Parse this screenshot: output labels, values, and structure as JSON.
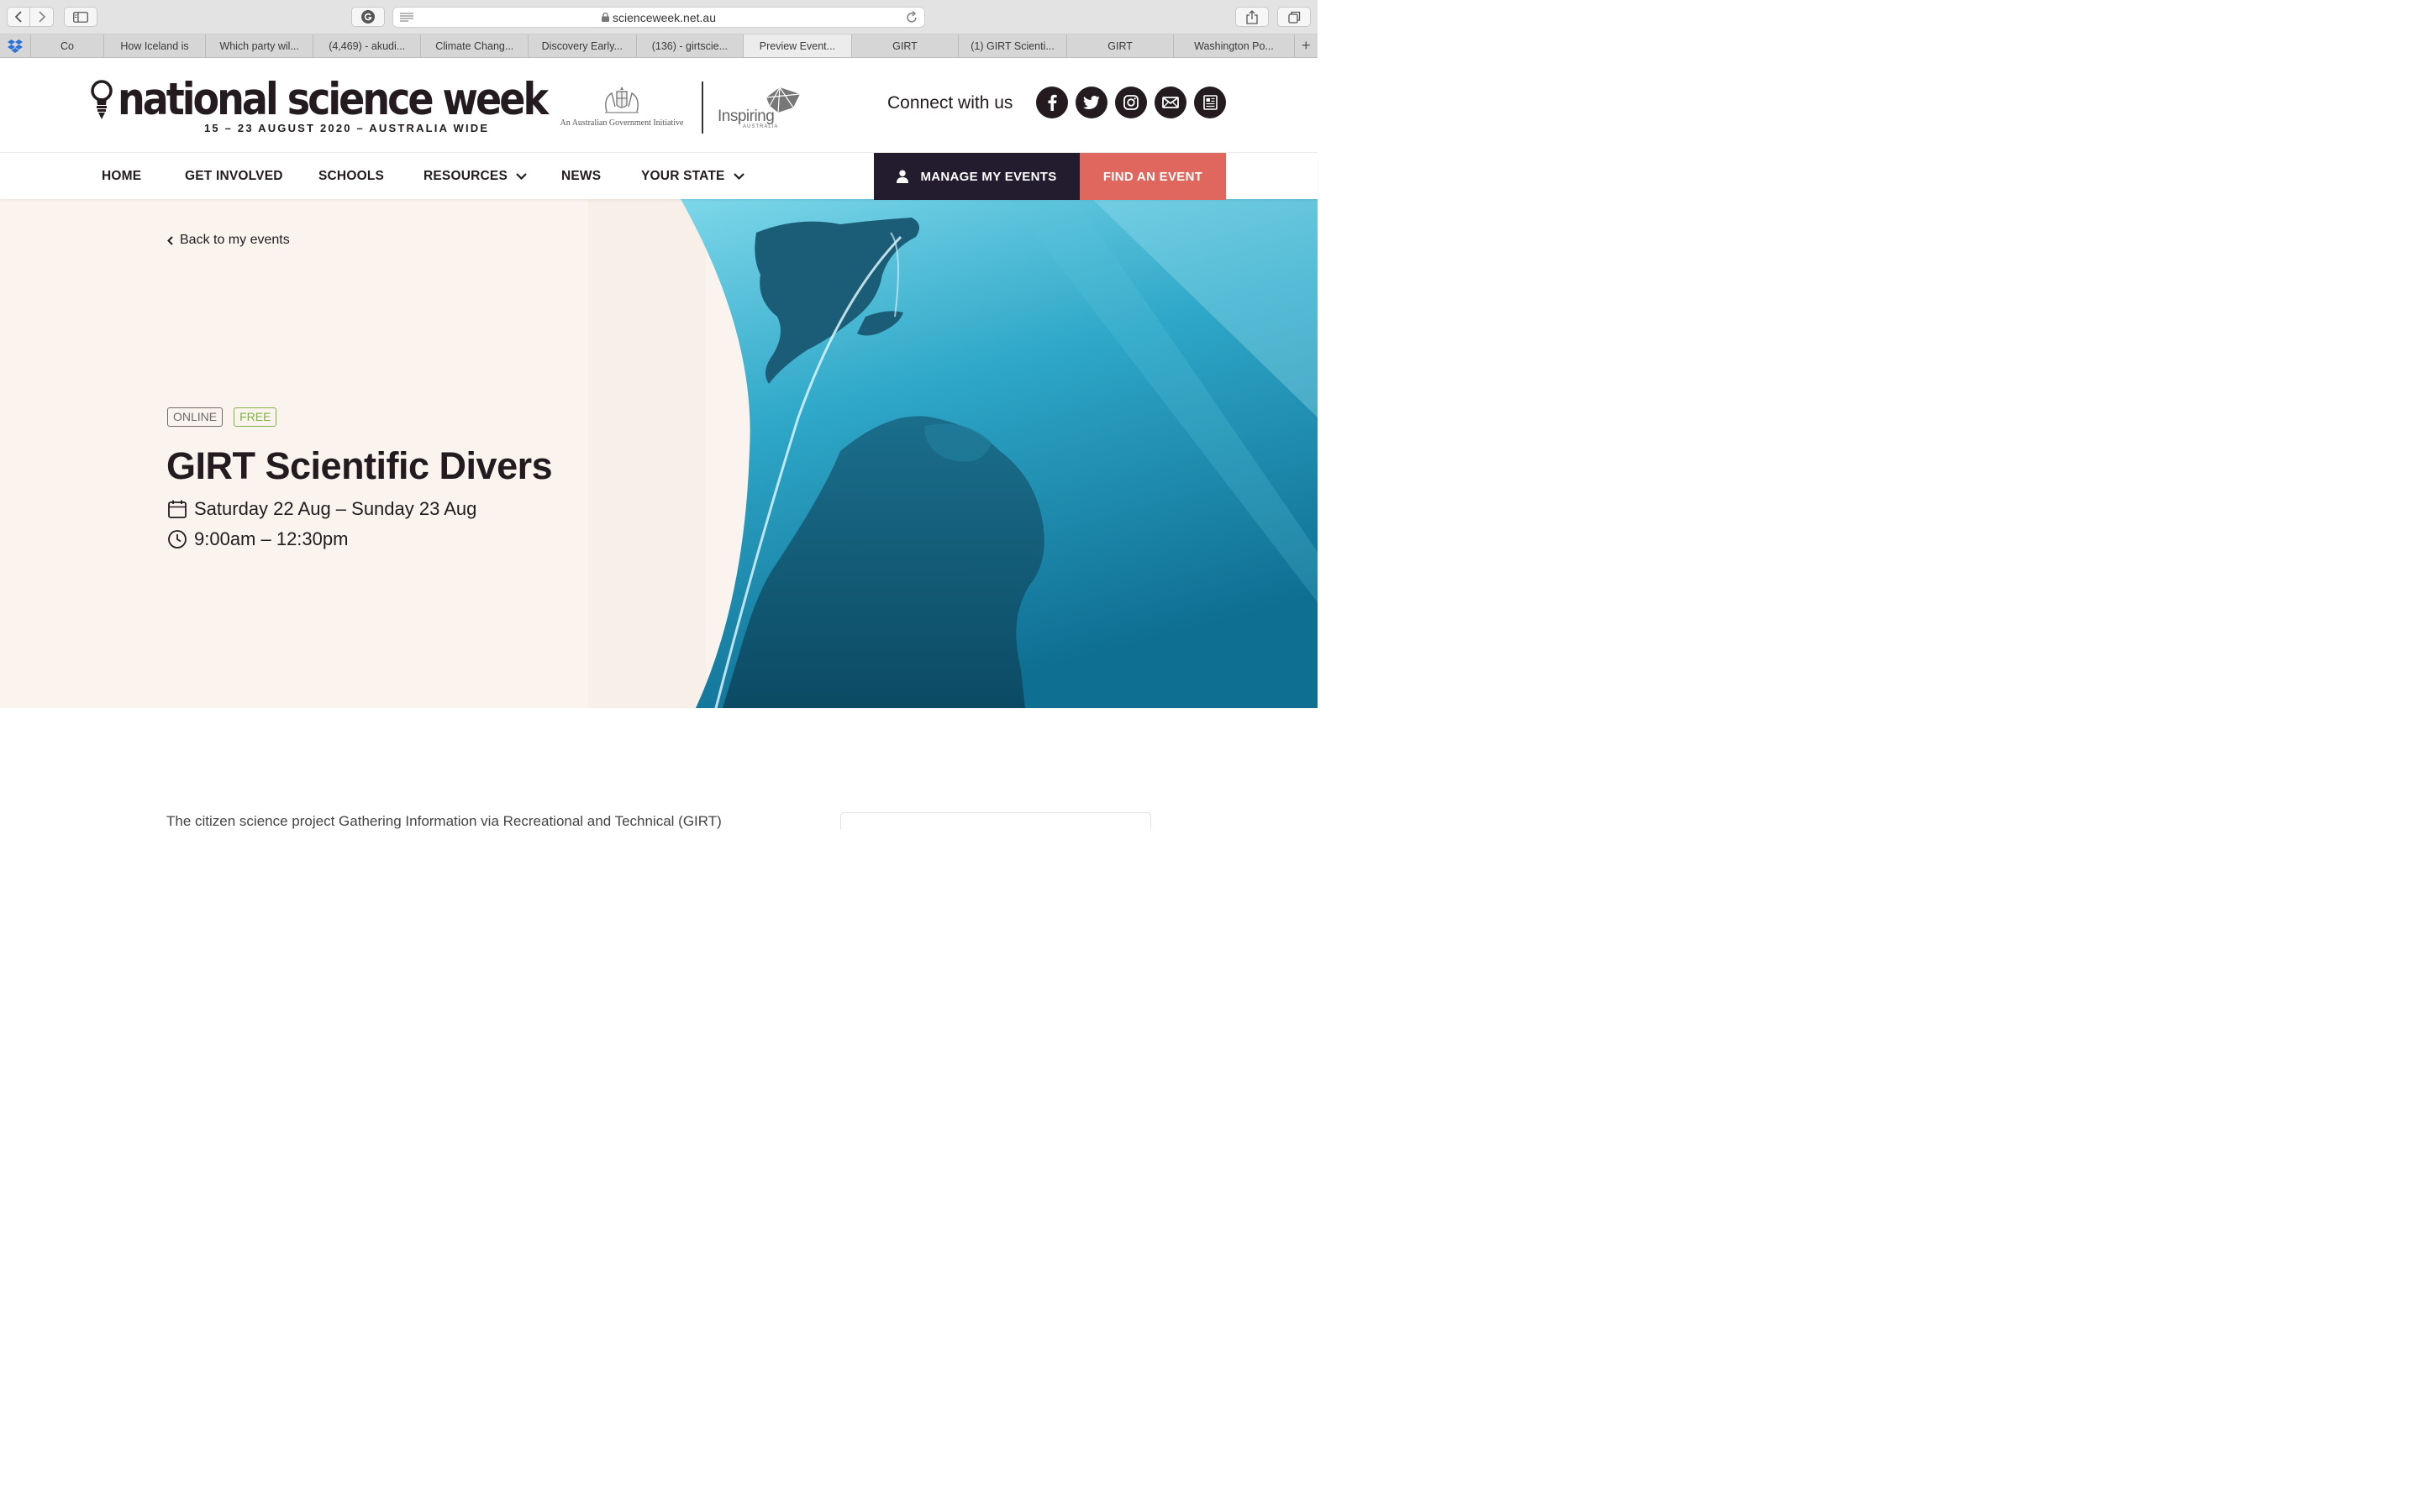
{
  "browser": {
    "url": "scienceweek.net.au",
    "tabs": [
      {
        "label": "Co",
        "width": 88
      },
      {
        "label": "How Iceland is",
        "width": 124
      },
      {
        "label": "Which party wil...",
        "width": 130
      },
      {
        "label": "(4,469) - akudi...",
        "width": 131
      },
      {
        "label": "Climate Chang...",
        "width": 130
      },
      {
        "label": "Discovery Early...",
        "width": 131
      },
      {
        "label": "(136) - girtscie...",
        "width": 130
      },
      {
        "label": "Preview Event...",
        "width": 131,
        "active": true
      },
      {
        "label": "GIRT",
        "width": 130
      },
      {
        "label": "(1) GIRT Scienti...",
        "width": 131
      },
      {
        "label": "GIRT",
        "width": 130
      },
      {
        "label": "Washington Po...",
        "width": 146
      }
    ]
  },
  "header": {
    "logo_wordmark": "national science week",
    "logo_tagline": "15 – 23 AUGUST 2020 – AUSTRALIA WIDE",
    "gov_text": "An Australian Government Initiative",
    "inspiring": "Inspiring",
    "inspiring_sub": "AUSTRALIA",
    "connect_label": "Connect with us"
  },
  "nav": {
    "items": [
      "HOME",
      "GET INVOLVED",
      "SCHOOLS",
      "RESOURCES",
      "NEWS",
      "YOUR STATE"
    ],
    "manage_label": "MANAGE MY EVENTS",
    "find_label": "FIND AN EVENT"
  },
  "hero": {
    "back_label": "Back to my events",
    "badge_online": "ONLINE",
    "badge_free": "FREE",
    "title": "GIRT Scientific Divers",
    "dates": "Saturday 22 Aug – Sunday 23 Aug",
    "time": "9:00am – 12:30pm"
  },
  "body": {
    "intro": "The citizen science project Gathering Information via Recreational and Technical (GIRT)"
  },
  "icons": [
    "back-icon",
    "forward-icon",
    "sidebar-icon",
    "grammarly-icon",
    "reader-icon",
    "lock-icon",
    "reload-icon",
    "share-icon",
    "tabs-overview-icon",
    "dropbox-icon",
    "new-tab-icon",
    "lightbulb-icon",
    "coat-of-arms-icon",
    "inspiring-australia-icon",
    "facebook-icon",
    "twitter-icon",
    "instagram-icon",
    "email-icon",
    "newsletter-icon",
    "chevron-down-icon",
    "user-icon",
    "chevron-left-icon",
    "calendar-icon",
    "clock-icon"
  ],
  "colors": {
    "brand_dark": "#231b1f",
    "manage_bg": "#231b2e",
    "find_bg": "#e0675e",
    "hero_bg": "#faf3ee",
    "free_green": "#7cb342",
    "water": "#2aa4c6"
  }
}
